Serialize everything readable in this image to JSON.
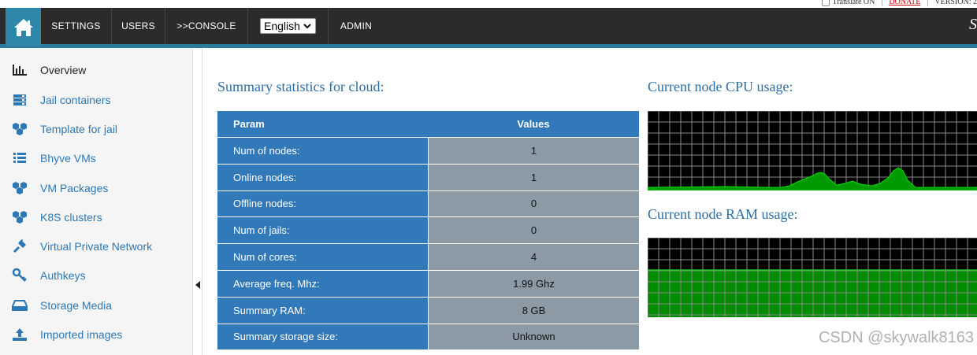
{
  "topbar": {
    "translate_label": "Translate ON",
    "donate_label": "DONATE",
    "version_label": "VERSION: 2"
  },
  "nav": {
    "home_icon": "home-icon",
    "items": [
      {
        "label": "SETTINGS"
      },
      {
        "label": "USERS"
      },
      {
        "label": ">>CONSOLE"
      },
      {
        "label": "ADMIN"
      }
    ],
    "language": "English",
    "brand": "S"
  },
  "sidebar": {
    "items": [
      {
        "label": "Overview",
        "icon": "bar-chart-icon",
        "active": true
      },
      {
        "label": "Jail containers",
        "icon": "server-stack-icon"
      },
      {
        "label": "Template for jail",
        "icon": "cubes-icon"
      },
      {
        "label": "Bhyve VMs",
        "icon": "list-icon"
      },
      {
        "label": "VM Packages",
        "icon": "cubes-icon"
      },
      {
        "label": "K8S clusters",
        "icon": "cubes-icon"
      },
      {
        "label": "Virtual Private Network",
        "icon": "plug-icon"
      },
      {
        "label": "Authkeys",
        "icon": "key-icon"
      },
      {
        "label": "Storage Media",
        "icon": "drive-icon"
      },
      {
        "label": "Imported images",
        "icon": "upload-icon"
      }
    ]
  },
  "main": {
    "summary_title": "Summary statistics for cloud:",
    "cpu_title": "Current node CPU usage:",
    "ram_title": "Current node RAM usage:",
    "table": {
      "headers": [
        "Param",
        "Values"
      ],
      "rows": [
        {
          "param": "Num of nodes:",
          "value": "1"
        },
        {
          "param": "Online nodes:",
          "value": "1"
        },
        {
          "param": "Offline nodes:",
          "value": "0"
        },
        {
          "param": "Num of jails:",
          "value": "0"
        },
        {
          "param": "Num of cores:",
          "value": "4"
        },
        {
          "param": "Average freq. Mhz:",
          "value": "1.99 Ghz"
        },
        {
          "param": "Summary RAM:",
          "value": "8 GB"
        },
        {
          "param": "Summary storage size:",
          "value": "Unknown"
        }
      ]
    }
  },
  "watermark": "CSDN @skywalk8163",
  "colors": {
    "accent": "#2e86a8",
    "table_blue": "#3179b8",
    "table_gray": "#8c9aa6",
    "graph_green": "#00cc00"
  }
}
